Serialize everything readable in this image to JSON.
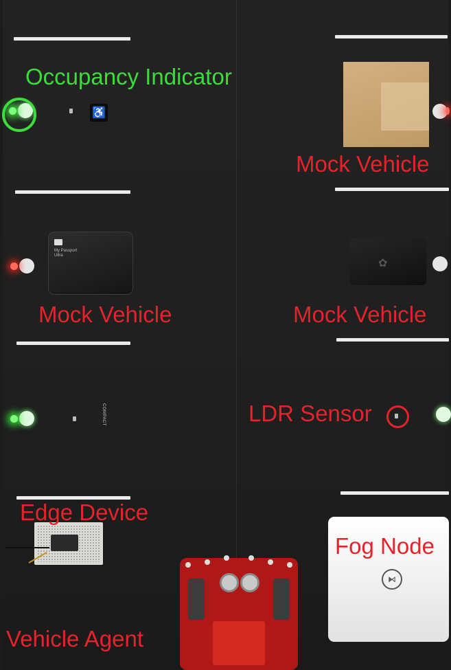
{
  "labels": {
    "occupancy_indicator": "Occupancy Indicator",
    "mock_vehicle_top_right": "Mock Vehicle",
    "mock_vehicle_middle_left": "Mock Vehicle",
    "mock_vehicle_middle_right": "Mock Vehicle",
    "ldr_sensor": "LDR Sensor",
    "edge_device": "Edge Device",
    "fog_node": "Fog Node",
    "vehicle_agent": "Vehicle Agent"
  },
  "printed_text": {
    "hdd_brand": "WD",
    "hdd_text": "My Passport\nUltra",
    "compact_text": "COMPACT"
  },
  "colors": {
    "annotation_red": "#e4232b",
    "annotation_green": "#3ddc3d",
    "board": "#1f1f1f",
    "lane_marking": "#eaeaea"
  },
  "led_states": {
    "slot_1_left": "green",
    "slot_2_left": "red",
    "slot_3_left": "green",
    "slot_1_right": "red",
    "slot_2_right": "off",
    "slot_3_right": "green"
  }
}
